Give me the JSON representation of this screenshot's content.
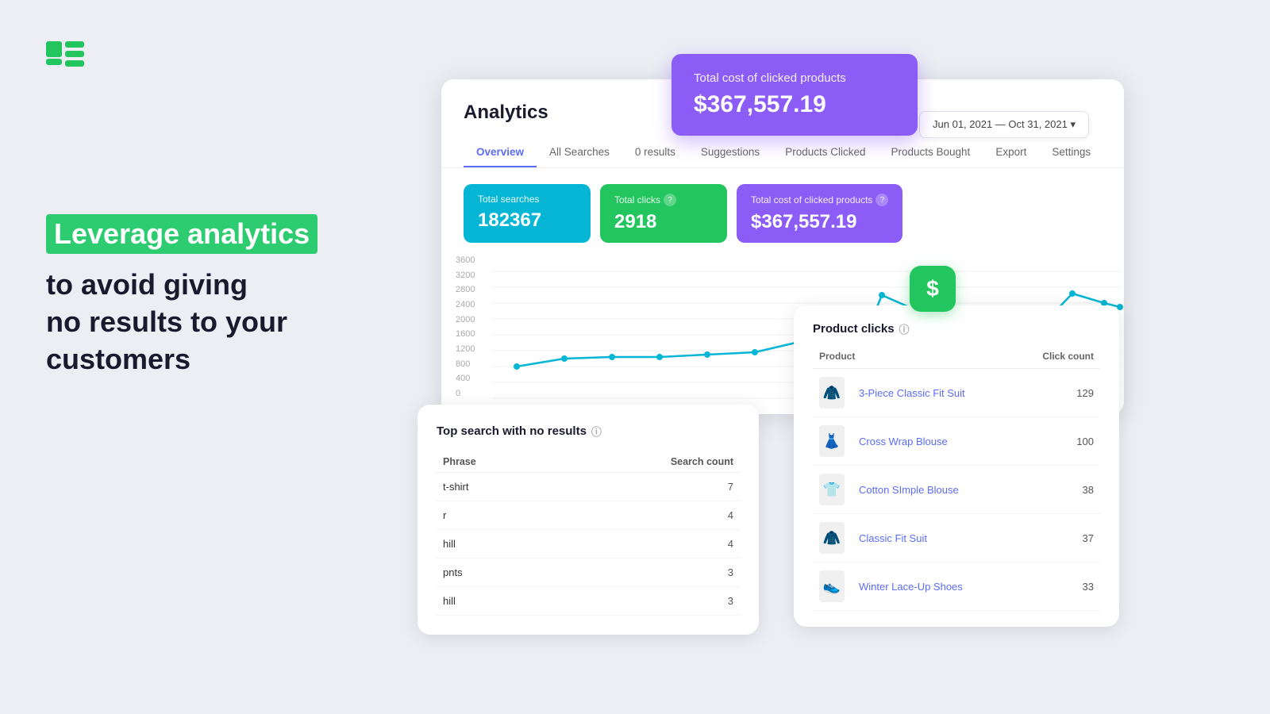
{
  "logo": {
    "alt": "App logo"
  },
  "left_text": {
    "highlight": "Leverage analytics",
    "subtitle_line1": "to avoid giving",
    "subtitle_line2": "no results to your",
    "subtitle_line3": "customers"
  },
  "cost_card_top": {
    "label": "Total cost of clicked products",
    "value": "$367,557.19"
  },
  "date_picker": {
    "label": "Jun 01, 2021 — Oct 31, 2021 ▾"
  },
  "analytics": {
    "title": "Analytics",
    "tabs": [
      {
        "id": "overview",
        "label": "Overview",
        "active": true
      },
      {
        "id": "all-searches",
        "label": "All Searches",
        "active": false
      },
      {
        "id": "0-results",
        "label": "0 results",
        "active": false
      },
      {
        "id": "suggestions",
        "label": "Suggestions",
        "active": false
      },
      {
        "id": "products-clicked",
        "label": "Products Clicked",
        "active": false
      },
      {
        "id": "products-bought",
        "label": "Products Bought",
        "active": false
      },
      {
        "id": "export",
        "label": "Export",
        "active": false
      },
      {
        "id": "settings",
        "label": "Settings",
        "active": false
      }
    ],
    "stat_cards": [
      {
        "label": "Total searches",
        "value": "182367",
        "color": "teal",
        "has_tooltip": false
      },
      {
        "label": "Total clicks",
        "value": "2918",
        "color": "green",
        "has_tooltip": true
      },
      {
        "label": "Total cost of clicked products",
        "value": "$367,557.19",
        "color": "purple",
        "has_tooltip": true
      }
    ],
    "chart": {
      "y_labels": [
        "3600",
        "3200",
        "2800",
        "2400",
        "2000",
        "1600",
        "1200",
        "800",
        "400",
        "0"
      ]
    }
  },
  "no_results": {
    "title": "Top search with no results",
    "columns": [
      "Phrase",
      "Search count"
    ],
    "rows": [
      {
        "phrase": "t-shirt",
        "count": "7"
      },
      {
        "phrase": "r",
        "count": "4"
      },
      {
        "phrase": "hill",
        "count": "4"
      },
      {
        "phrase": "pnts",
        "count": "3"
      },
      {
        "phrase": "hill",
        "count": "3"
      }
    ]
  },
  "product_clicks": {
    "title": "Product clicks",
    "columns": [
      "Product",
      "Click count"
    ],
    "rows": [
      {
        "name": "3-Piece Classic Fit Suit",
        "count": "129",
        "emoji": "🧥"
      },
      {
        "name": "Cross Wrap Blouse",
        "count": "100",
        "emoji": "👗"
      },
      {
        "name": "Cotton SImple Blouse",
        "count": "38",
        "emoji": "👕"
      },
      {
        "name": "Classic Fit Suit",
        "count": "37",
        "emoji": "🧥"
      },
      {
        "name": "Winter Lace-Up Shoes",
        "count": "33",
        "emoji": "👟"
      }
    ]
  }
}
